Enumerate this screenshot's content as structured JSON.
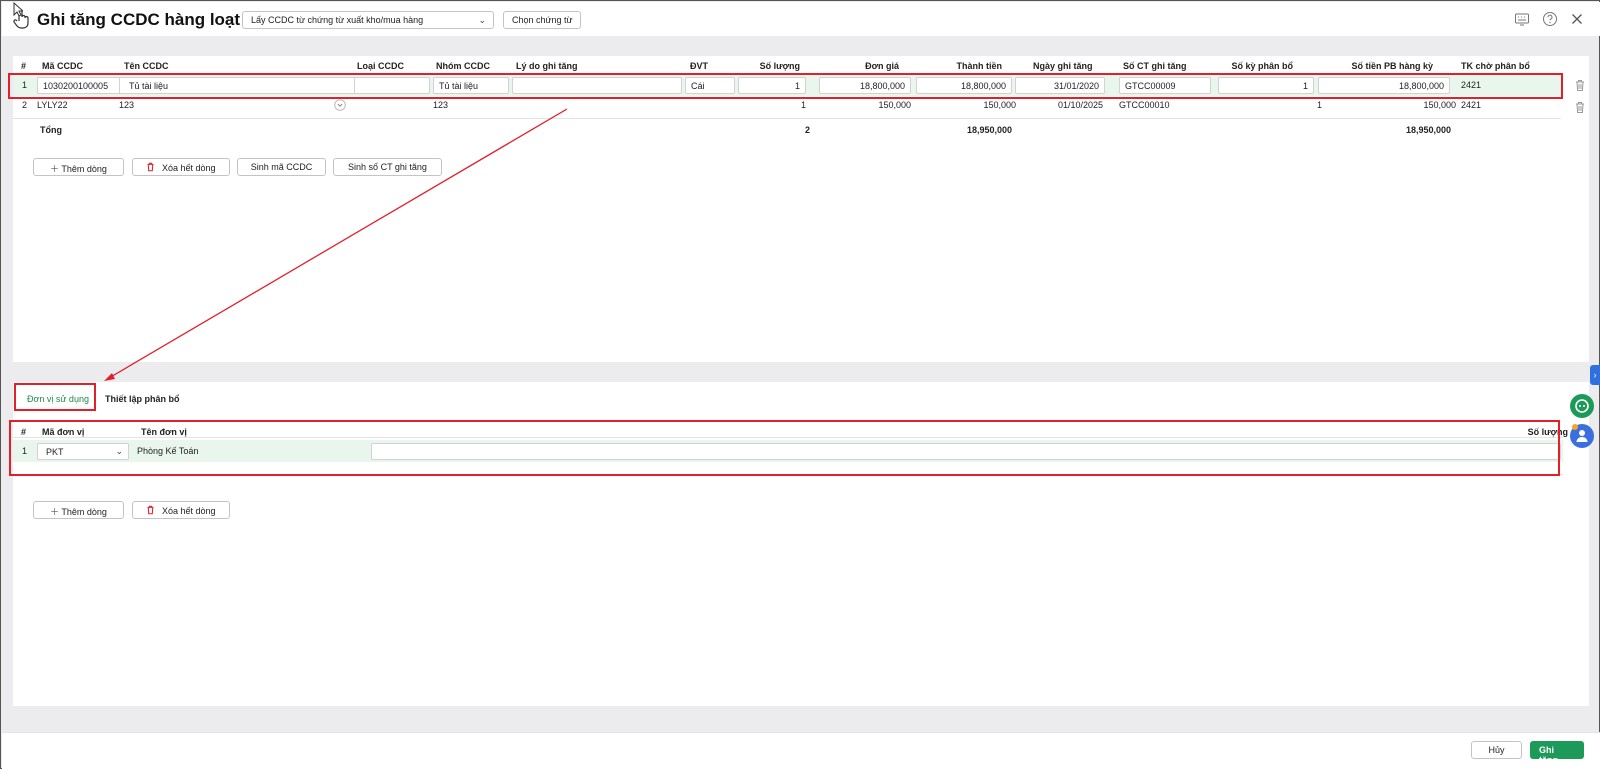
{
  "header": {
    "title": "Ghi tăng CCDC hàng loạt",
    "source_select": "Lấy CCDC từ chứng từ xuất kho/mua hàng",
    "choose_voucher_label": "Chọn chứng từ",
    "icons": [
      "keyboard-icon",
      "help-icon",
      "close-icon"
    ]
  },
  "main_grid": {
    "columns": [
      "#",
      "Mã CCDC",
      "Tên CCDC",
      "Loại CCDC",
      "Nhóm CCDC",
      "Lý do ghi tăng",
      "ĐVT",
      "Số lượng",
      "Đơn giá",
      "Thành tiền",
      "Ngày ghi tăng",
      "Số CT ghi tăng",
      "Số kỳ phân bổ",
      "Số tiền PB hàng kỳ",
      "TK chờ phân bổ"
    ],
    "rows": [
      [
        "1",
        "1030200100005",
        "Tủ tài liệu",
        "",
        "Tủ tài liệu",
        "",
        "Cái",
        "1",
        "18,800,000",
        "18,800,000",
        "31/01/2020",
        "GTCC00009",
        "1",
        "18,800,000",
        "2421"
      ],
      [
        "2",
        "LYLY22",
        "123",
        "",
        "123",
        "",
        "",
        "1",
        "150,000",
        "150,000",
        "01/10/2025",
        "GTCC00010",
        "1",
        "150,000",
        "2421"
      ]
    ],
    "total": {
      "label": "Tổng",
      "quantity": "2",
      "amount": "18,950,000",
      "periodic_amount": "18,950,000"
    },
    "actions": {
      "add_row": "Thêm dòng",
      "delete_all": "Xóa hết dòng",
      "gen_code": "Sinh mã CCDC",
      "gen_voucher_no": "Sinh số CT ghi tăng"
    }
  },
  "tabs": {
    "active": "Đơn vị sử dụng",
    "other": "Thiết lập phân bổ"
  },
  "unit_grid": {
    "columns": [
      "#",
      "Mã đơn vị",
      "Tên đơn vị",
      "Số lượng"
    ],
    "rows": [
      {
        "index": "1",
        "code": "PKT",
        "name": "Phòng Kế Toán",
        "quantity": ""
      }
    ],
    "actions": {
      "add_row": "Thêm dòng",
      "delete_all": "Xóa hết dòng"
    }
  },
  "footer": {
    "cancel": "Hủy",
    "save": "Ghi tăng"
  },
  "colors": {
    "accent": "#1d9a59",
    "highlight": "#e2202a",
    "delete": "#e2202a",
    "side_tab": "#2f6fe0"
  }
}
